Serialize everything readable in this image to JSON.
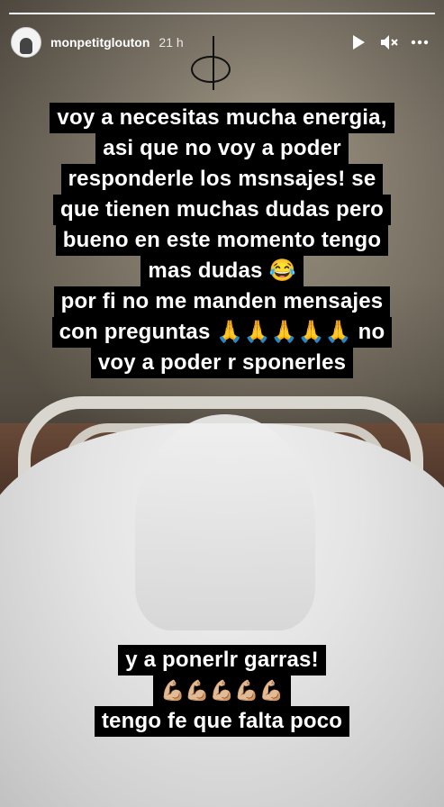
{
  "story": {
    "progress": 1.0,
    "username": "monpetitglouton",
    "time_ago": "21 h"
  },
  "icons": {
    "play": "play-icon",
    "mute": "mute-icon",
    "more": "more-icon"
  },
  "caption_top": {
    "lines": [
      "voy a necesitas mucha energia,",
      "asi que no voy a poder",
      "responderle los msnsajes! se",
      "que tienen muchas dudas pero",
      "bueno en este momento tengo",
      "mas dudas 😂",
      "por fi no me manden  mensajes",
      "con preguntas 🙏🙏🙏🙏🙏 no",
      "voy a poder r sponerles"
    ]
  },
  "caption_bottom": {
    "line1": "y a ponerlr garras!",
    "emojis": "💪🏼💪🏼💪🏼💪🏼💪🏼",
    "line2": "tengo fe que falta poco"
  }
}
